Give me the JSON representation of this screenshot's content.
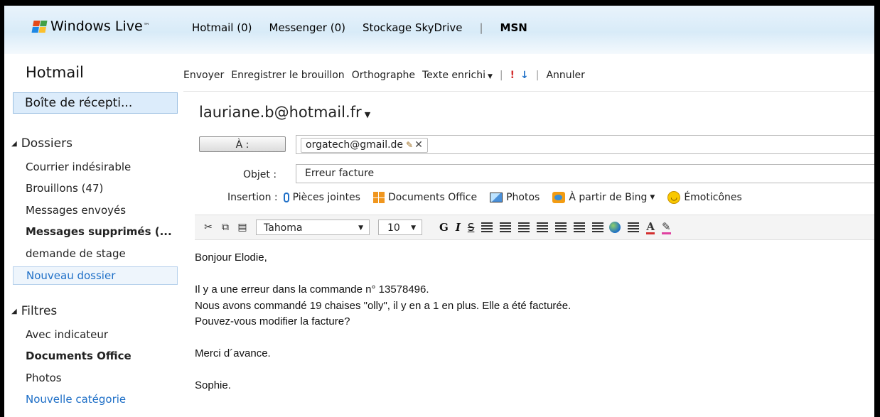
{
  "topbar": {
    "brand": "Windows Live",
    "brand_tm": "™",
    "nav": [
      "Hotmail (0)",
      "Messenger (0)",
      "Stockage SkyDrive"
    ],
    "separator": "|",
    "msn": "MSN"
  },
  "sidebar": {
    "app_title": "Hotmail",
    "inbox": "Boîte de récepti...",
    "folders_head": "Dossiers",
    "folders": [
      {
        "label": "Courrier indésirable"
      },
      {
        "label": "Brouillons (47)"
      },
      {
        "label": "Messages envoyés"
      },
      {
        "label": "Messages supprimés (..."
      },
      {
        "label": "demande de stage"
      },
      {
        "label": "Nouveau dossier"
      }
    ],
    "filters_head": "Filtres",
    "filters": [
      {
        "label": "Avec indicateur"
      },
      {
        "label": "Documents Office"
      },
      {
        "label": "Photos"
      },
      {
        "label": "Nouvelle catégorie"
      }
    ]
  },
  "toolbar": {
    "send": "Envoyer",
    "save_draft": "Enregistrer le brouillon",
    "spelling": "Orthographe",
    "rich_text": "Texte enrichi",
    "high_importance": "!",
    "low_importance": "↓",
    "cancel": "Annuler",
    "pipe": "|"
  },
  "compose": {
    "from": "lauriane.b@hotmail.fr",
    "to_button": "À :",
    "to_recipient": "orgatech@gmail.de",
    "subject_label": "Objet :",
    "subject": "Erreur facture",
    "insert_label": "Insertion :",
    "insert_items": {
      "attachments": "Pièces jointes",
      "office_docs": "Documents Office",
      "photos": "Photos",
      "bing": "À partir de Bing",
      "emoticons": "Émoticônes"
    },
    "font_family": "Tahoma",
    "font_size": "10",
    "bold": "G",
    "italic": "I",
    "strike": "S",
    "font_color": "A",
    "body_lines": [
      "Bonjour Elodie,",
      "",
      "Il y a une erreur dans la commande n° 13578496.",
      "Nous avons commandé 19 chaises \"olly\", il y en a 1 en plus. Elle a été facturée.",
      "Pouvez-vous modifier la facture?",
      "",
      "Merci d´avance.",
      "",
      "Sophie."
    ]
  },
  "colors": {
    "link": "#1e6fc7",
    "topbar_bg": "#d8ebf8",
    "selected_bg": "#dcecfb",
    "importance_high": "#d32f2f"
  }
}
